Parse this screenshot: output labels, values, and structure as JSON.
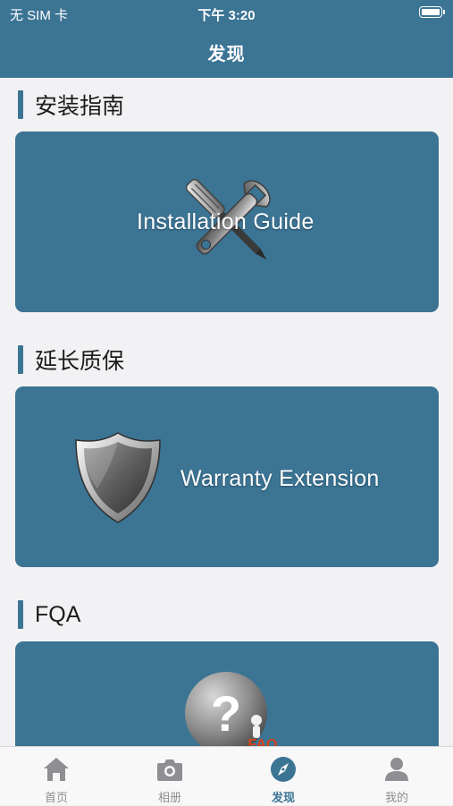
{
  "status_bar": {
    "carrier": "无 SIM 卡",
    "time": "下午 3:20"
  },
  "nav": {
    "title": "发现"
  },
  "sections": [
    {
      "title": "安装指南",
      "card_label": "Installation Guide",
      "icon": "tools-icon"
    },
    {
      "title": "延长质保",
      "card_label": "Warranty Extension",
      "icon": "shield-icon"
    },
    {
      "title": "FQA",
      "card_label": "FAQ",
      "icon": "question-icon"
    }
  ],
  "tabbar": {
    "items": [
      {
        "label": "首页",
        "icon": "home-icon",
        "active": false
      },
      {
        "label": "相册",
        "icon": "camera-icon",
        "active": false
      },
      {
        "label": "发现",
        "icon": "compass-icon",
        "active": true
      },
      {
        "label": "我的",
        "icon": "person-icon",
        "active": false
      }
    ]
  },
  "colors": {
    "primary": "#3c7494",
    "background": "#f2f2f4",
    "inactive": "#8e8e93"
  }
}
